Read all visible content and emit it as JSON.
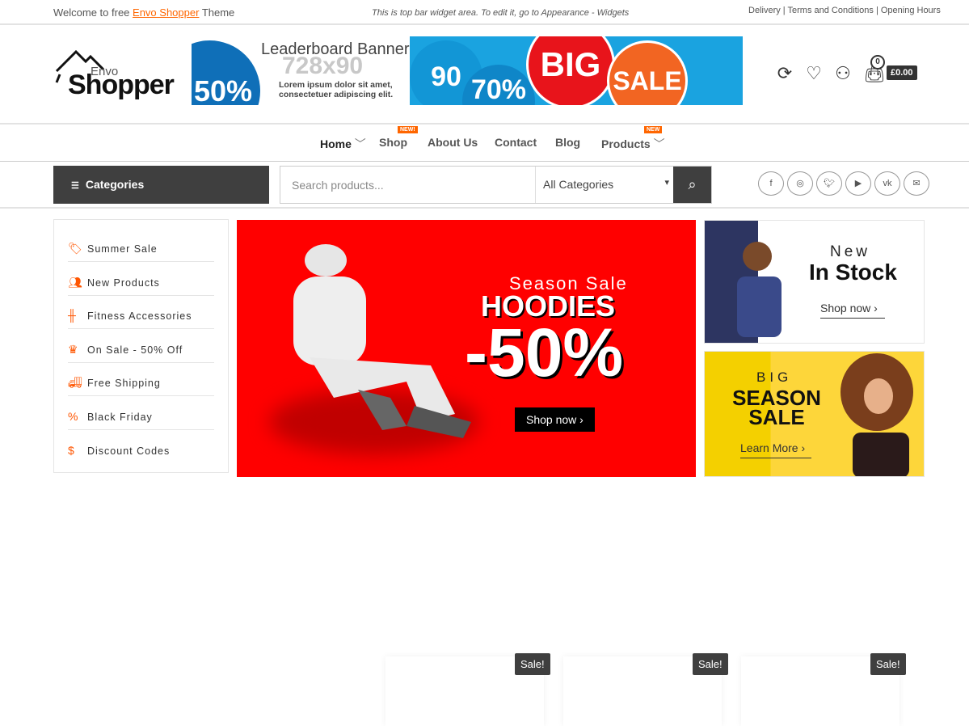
{
  "topbar": {
    "welcome_pre": "Welcome to free ",
    "welcome_link": "Envo Shopper",
    "welcome_post": " Theme",
    "widget": "This is top bar widget area. To edit it, go to Appearance - Widgets",
    "links": "Delivery | Terms and Conditions | Opening Hours"
  },
  "logo": {
    "envo": "Envo",
    "shopper": "Shopper"
  },
  "leaderboard": {
    "title": "Leaderboard Banner",
    "size": "728x90",
    "lorem": "Lorem ipsum dolor sit amet,",
    "lorem2": "consectetuer adipiscing elit.",
    "big": "BIG",
    "sale": "SALE",
    "p50": "50%",
    "p90": "90",
    "p70": "70%"
  },
  "header": {
    "cart_count": "0",
    "cart_total": "£0.00",
    "icons": [
      "refresh-icon",
      "heart-icon",
      "user-icon",
      "bag-icon"
    ]
  },
  "nav": [
    {
      "label": "Home"
    },
    {
      "label": "Shop",
      "badge": "NEW!"
    },
    {
      "label": "About Us"
    },
    {
      "label": "Contact"
    },
    {
      "label": "Blog"
    },
    {
      "label": "Products",
      "badge": "NEW"
    }
  ],
  "categories_button": "Categories",
  "search": {
    "placeholder": "Search products...",
    "category": "All Categories"
  },
  "socials": [
    "facebook-icon",
    "instagram-icon",
    "twitter-icon",
    "youtube-icon",
    "vk-icon",
    "email-icon"
  ],
  "sidebar": [
    {
      "label": "Summer Sale",
      "icon": "tag-icon"
    },
    {
      "label": "New Products",
      "icon": "users-icon"
    },
    {
      "label": "Fitness Accessories",
      "icon": "dumbbell-icon"
    },
    {
      "label": "On Sale - 50% Off",
      "icon": "basket-icon"
    },
    {
      "label": "Free Shipping",
      "icon": "truck-icon"
    },
    {
      "label": "Black Friday",
      "icon": "percent-icon"
    },
    {
      "label": "Discount Codes",
      "icon": "dollar-icon"
    }
  ],
  "hero": {
    "kicker": "Season Sale",
    "title": "HOODIES",
    "discount": "-50%",
    "button": "Shop now",
    "bg": "#ff0000"
  },
  "banner1": {
    "line1": "New",
    "line2": "In Stock",
    "button": "Shop now"
  },
  "banner2": {
    "line1": "BIG",
    "line2": "SEASON",
    "line3": "SALE",
    "button": "Learn More"
  },
  "products": [
    {
      "badge": "Sale!"
    },
    {
      "badge": "Sale!"
    },
    {
      "badge": "Sale!"
    }
  ],
  "colors": {
    "accent": "#ff6600",
    "dark": "#3f3f3f"
  }
}
